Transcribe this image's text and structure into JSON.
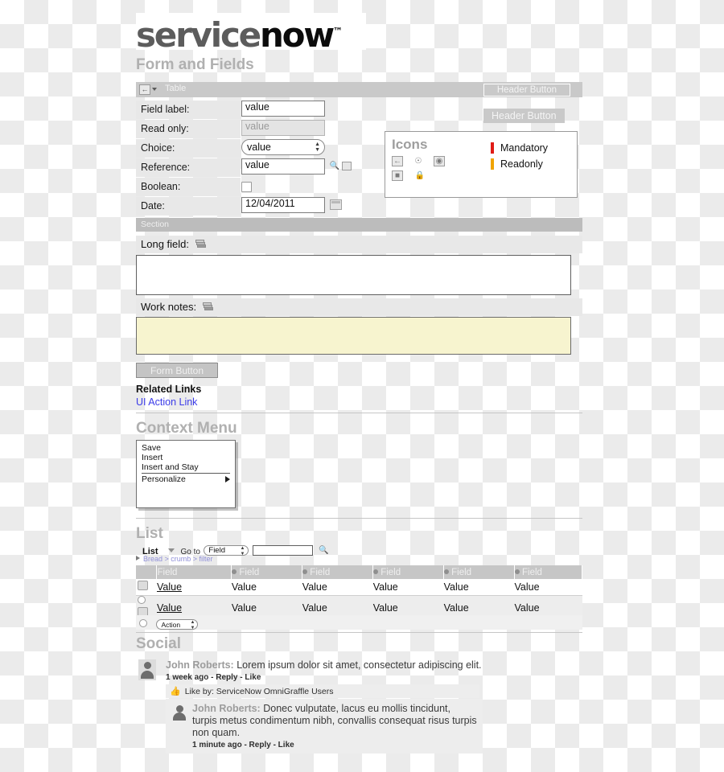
{
  "logo": {
    "part1": "service",
    "part2": "now",
    "tm": "™"
  },
  "sections": {
    "form": "Form and Fields",
    "context_menu": "Context Menu",
    "list": "List",
    "social": "Social"
  },
  "form": {
    "title_bar": {
      "label": "Table",
      "back_icon": "back-arrow-icon",
      "header_button": "Header Button"
    },
    "floating_header_button": "Header Button",
    "rows": [
      {
        "label": "Field label:",
        "type": "text",
        "value": "value"
      },
      {
        "label": "Read only:",
        "type": "text-readonly",
        "value": "value"
      },
      {
        "label": "Choice:",
        "type": "select",
        "value": "value"
      },
      {
        "label": "Reference:",
        "type": "reference",
        "value": "value"
      },
      {
        "label": "Boolean:",
        "type": "checkbox",
        "value": ""
      },
      {
        "label": "Date:",
        "type": "date",
        "value": "12/04/2011"
      }
    ],
    "section_label": "Section",
    "long_field_label": "Long field:",
    "work_notes_label": "Work notes:",
    "long_field_value": "",
    "work_notes_value": "",
    "form_button": "Form Button",
    "related_links_title": "Related Links",
    "ui_action_link": "UI Action Link"
  },
  "icons_legend": {
    "title": "Icons",
    "row1": [
      "back-arrow-icon",
      "lock-globe-icon",
      "preview-record-icon"
    ],
    "row2": [
      "calendar-icon",
      "padlock-icon"
    ],
    "items": [
      {
        "label": "Mandatory",
        "color": "#e01b16"
      },
      {
        "label": "Readonly",
        "color": "#f0a400"
      }
    ]
  },
  "context_menu": {
    "items": [
      "Save",
      "Insert",
      "Insert and Stay",
      "Personalize"
    ],
    "submenu_indicator_on": "Personalize"
  },
  "list": {
    "toolbar": {
      "title": "List",
      "goto_label": "Go to",
      "field_select": "Field",
      "search_value": "",
      "search_icon": "search-icon"
    },
    "breadcrumb": "Bread > crumb > filter",
    "columns": [
      "Field",
      "Field",
      "Field",
      "Field",
      "Field",
      "Field"
    ],
    "rows": [
      {
        "cells": [
          "Value",
          "Value",
          "Value",
          "Value",
          "Value",
          "Value"
        ],
        "has_checkbox": false
      },
      {
        "cells": [
          "Value",
          "Value",
          "Value",
          "Value",
          "Value",
          "Value"
        ],
        "has_checkbox": true
      }
    ],
    "footer_action": "Action"
  },
  "social": {
    "comments": [
      {
        "author": "John Roberts:",
        "text": "Lorem ipsum dolor sit amet, consectetur adipiscing elit.",
        "meta": "1 week ago - Reply - Like",
        "like_bar": "Like by: ServiceNow OmniGraffle Users"
      },
      {
        "author": "John Roberts:",
        "text": "Donec vulputate, lacus eu mollis tincidunt, turpis metus condimentum nibh, convallis consequat risus turpis non quam.",
        "meta": "1 minute ago - Reply - Like"
      }
    ]
  }
}
